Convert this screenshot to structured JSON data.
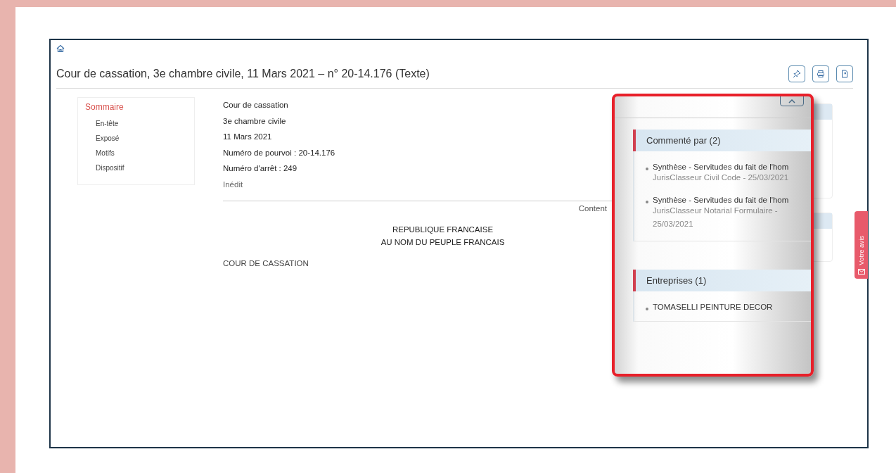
{
  "header": {
    "title": "Cour de cassation, 3e chambre civile, 11 Mars 2021 – n° 20-14.176 (Texte)"
  },
  "summary": {
    "title": "Sommaire",
    "items": [
      "En-tête",
      "Exposé",
      "Motifs",
      "Dispositif"
    ]
  },
  "decision": {
    "meta": [
      {
        "text": "Cour de cassation",
        "kind": "strong"
      },
      {
        "text": "3e chambre civile",
        "kind": "strong"
      },
      {
        "text": "11 Mars 2021",
        "kind": "strong"
      },
      {
        "text": "Numéro de pourvoi : 20-14.176",
        "kind": "strong"
      },
      {
        "text": "Numéro d'arrêt : 249",
        "kind": "strong"
      },
      {
        "text": "Inédit",
        "kind": "muted"
      }
    ],
    "content_label": "Content",
    "headings": [
      "REPUBLIQUE FRANCAISE",
      "AU NOM DU PEUPLE FRANCAIS"
    ],
    "court": "COUR DE CASSATION"
  },
  "feedback_tab": {
    "label": "Votre avis"
  },
  "zoom_panel": {
    "sections": [
      {
        "title": "Commenté par (2)",
        "items": [
          {
            "title": "Synthèse - Servitudes du fait de l'hom",
            "source": "JurisClasseur Civil Code - 25/03/2021"
          },
          {
            "title": "Synthèse - Servitudes du fait de l'hom",
            "source": "JurisClasseur Notarial Formulaire - 25/03/2021"
          }
        ]
      },
      {
        "title": "Entreprises (1)",
        "items": [
          {
            "title": "TOMASELLI PEINTURE DECOR"
          }
        ]
      }
    ]
  }
}
